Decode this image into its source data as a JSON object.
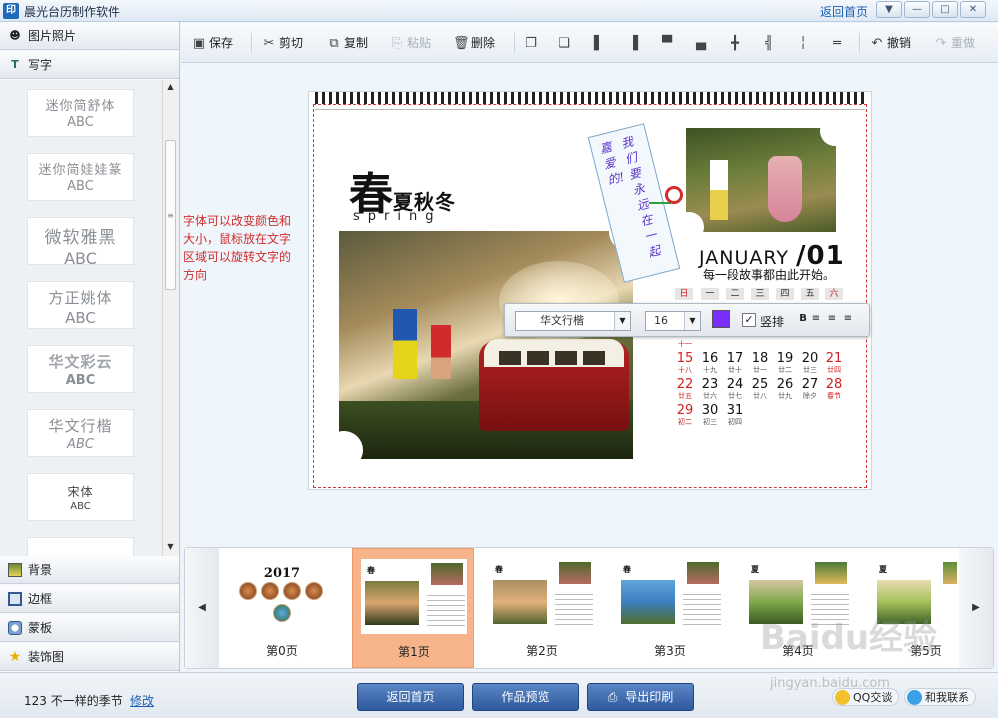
{
  "app": {
    "title": "晨光台历制作软件",
    "icon_text": "印",
    "home_link": "返回首页"
  },
  "window_controls": [
    "▼",
    "—",
    "□",
    "✕"
  ],
  "left_panel": {
    "top_tabs": [
      {
        "label": "图片照片",
        "icon": "person-icon"
      },
      {
        "label": "写字",
        "icon": "text-t-icon"
      }
    ],
    "fonts": [
      {
        "name": "迷你简舒体",
        "sample": "ABC"
      },
      {
        "name": "迷你简娃娃篆",
        "sample": "ABC"
      },
      {
        "name": "微软雅黑",
        "sample": "ABC"
      },
      {
        "name": "方正姚体",
        "sample": "ABC"
      },
      {
        "name": "华文彩云",
        "sample": "ABC"
      },
      {
        "name": "华文行楷",
        "sample": "ABC"
      },
      {
        "name": "宋体",
        "sample": "ABC"
      }
    ],
    "bottom_tabs": [
      {
        "label": "背景",
        "icon": "background-icon"
      },
      {
        "label": "边框",
        "icon": "frame-icon"
      },
      {
        "label": "蒙板",
        "icon": "mask-icon"
      },
      {
        "label": "装饰图",
        "icon": "star-icon"
      }
    ]
  },
  "toolbar": {
    "save": "保存",
    "cut": "剪切",
    "copy": "复制",
    "paste": "粘贴",
    "delete": "删除",
    "undo": "撤销",
    "redo": "重做"
  },
  "hint": "字体可以改变颜色和大小，鼠标放在文字区域可以旋转文字的方向",
  "calendar_page": {
    "season_big": "春",
    "season_rest": "夏秋冬",
    "season_en": "spring",
    "tag_columns": [
      "嘉爱的!",
      "我们要永远在一起"
    ],
    "month": "JANUARY",
    "month_num": "01",
    "motto": "每一段故事都由此开始。",
    "weekdays": [
      "日",
      "一",
      "二",
      "三",
      "四",
      "五",
      "六"
    ],
    "weeks": [
      [
        [
          "15",
          "十八",
          true
        ],
        [
          "16",
          "十九",
          false
        ],
        [
          "17",
          "廿十",
          false
        ],
        [
          "18",
          "廿一",
          false
        ],
        [
          "19",
          "廿二",
          false
        ],
        [
          "20",
          "廿三",
          false
        ],
        [
          "21",
          "廿四",
          true
        ]
      ],
      [
        [
          "22",
          "廿五",
          true
        ],
        [
          "23",
          "廿六",
          false
        ],
        [
          "24",
          "廿七",
          false
        ],
        [
          "25",
          "廿八",
          false
        ],
        [
          "26",
          "廿九",
          false
        ],
        [
          "27",
          "除夕",
          false
        ],
        [
          "28",
          "春节",
          true
        ]
      ],
      [
        [
          "29",
          "初二",
          true
        ],
        [
          "30",
          "初三",
          false
        ],
        [
          "31",
          "初四",
          false
        ]
      ]
    ],
    "week_prev_label": "十一"
  },
  "font_bar": {
    "font": "华文行楷",
    "size": "16",
    "color": "#7b2cff",
    "vertical_label": "竖排",
    "vertical_checked": "✓",
    "bold": "B",
    "align_left": "≡",
    "align_center": "≡",
    "align_right": "≡"
  },
  "pages": [
    {
      "label": "第0页",
      "title": "2017"
    },
    {
      "label": "第1页",
      "title": "春"
    },
    {
      "label": "第2页",
      "title": "春"
    },
    {
      "label": "第3页",
      "title": "春"
    },
    {
      "label": "第4页",
      "title": "夏"
    },
    {
      "label": "第5页",
      "title": "夏"
    }
  ],
  "status": {
    "text": "123 不一样的季节",
    "link": "修改"
  },
  "bottom_buttons": {
    "home": "返回首页",
    "preview": "作品预览",
    "export": "导出印刷"
  },
  "chat": {
    "qq": "QQ交谈",
    "contact": "和我联系"
  },
  "watermark": {
    "text": "Baidu经验",
    "sub": "jingyan.baidu.com"
  }
}
